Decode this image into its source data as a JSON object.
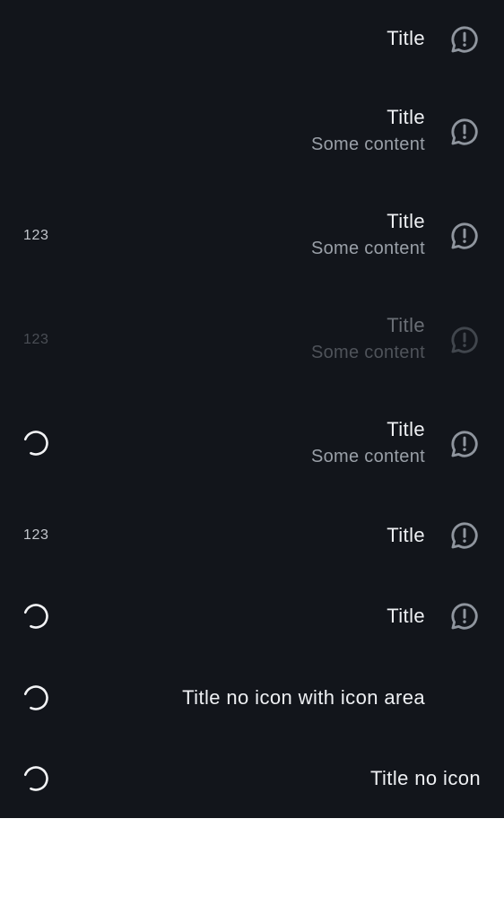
{
  "colors": {
    "background": "#12151b",
    "title_text": "#eef0f3",
    "content_text": "#9aa0a8",
    "icon": "#8f959e",
    "spinner": "#f2f3f5"
  },
  "icon_name": "feedback-icon",
  "rows": [
    {
      "title": "Title",
      "content": ""
    },
    {
      "title": "Title",
      "content": "Some content"
    },
    {
      "meta": "123",
      "title": "Title",
      "content": "Some content"
    },
    {
      "meta": "123",
      "title": "Title",
      "content": "Some content",
      "state": "disabled"
    },
    {
      "leading": "loading-spinner",
      "title": "Title",
      "content": "Some content"
    },
    {
      "meta": "123",
      "title": "Title"
    },
    {
      "leading": "loading-spinner",
      "title": "Title"
    },
    {
      "leading": "loading-spinner",
      "title": "Title no icon with icon area"
    },
    {
      "leading": "loading-spinner",
      "title": "Title no icon"
    }
  ]
}
